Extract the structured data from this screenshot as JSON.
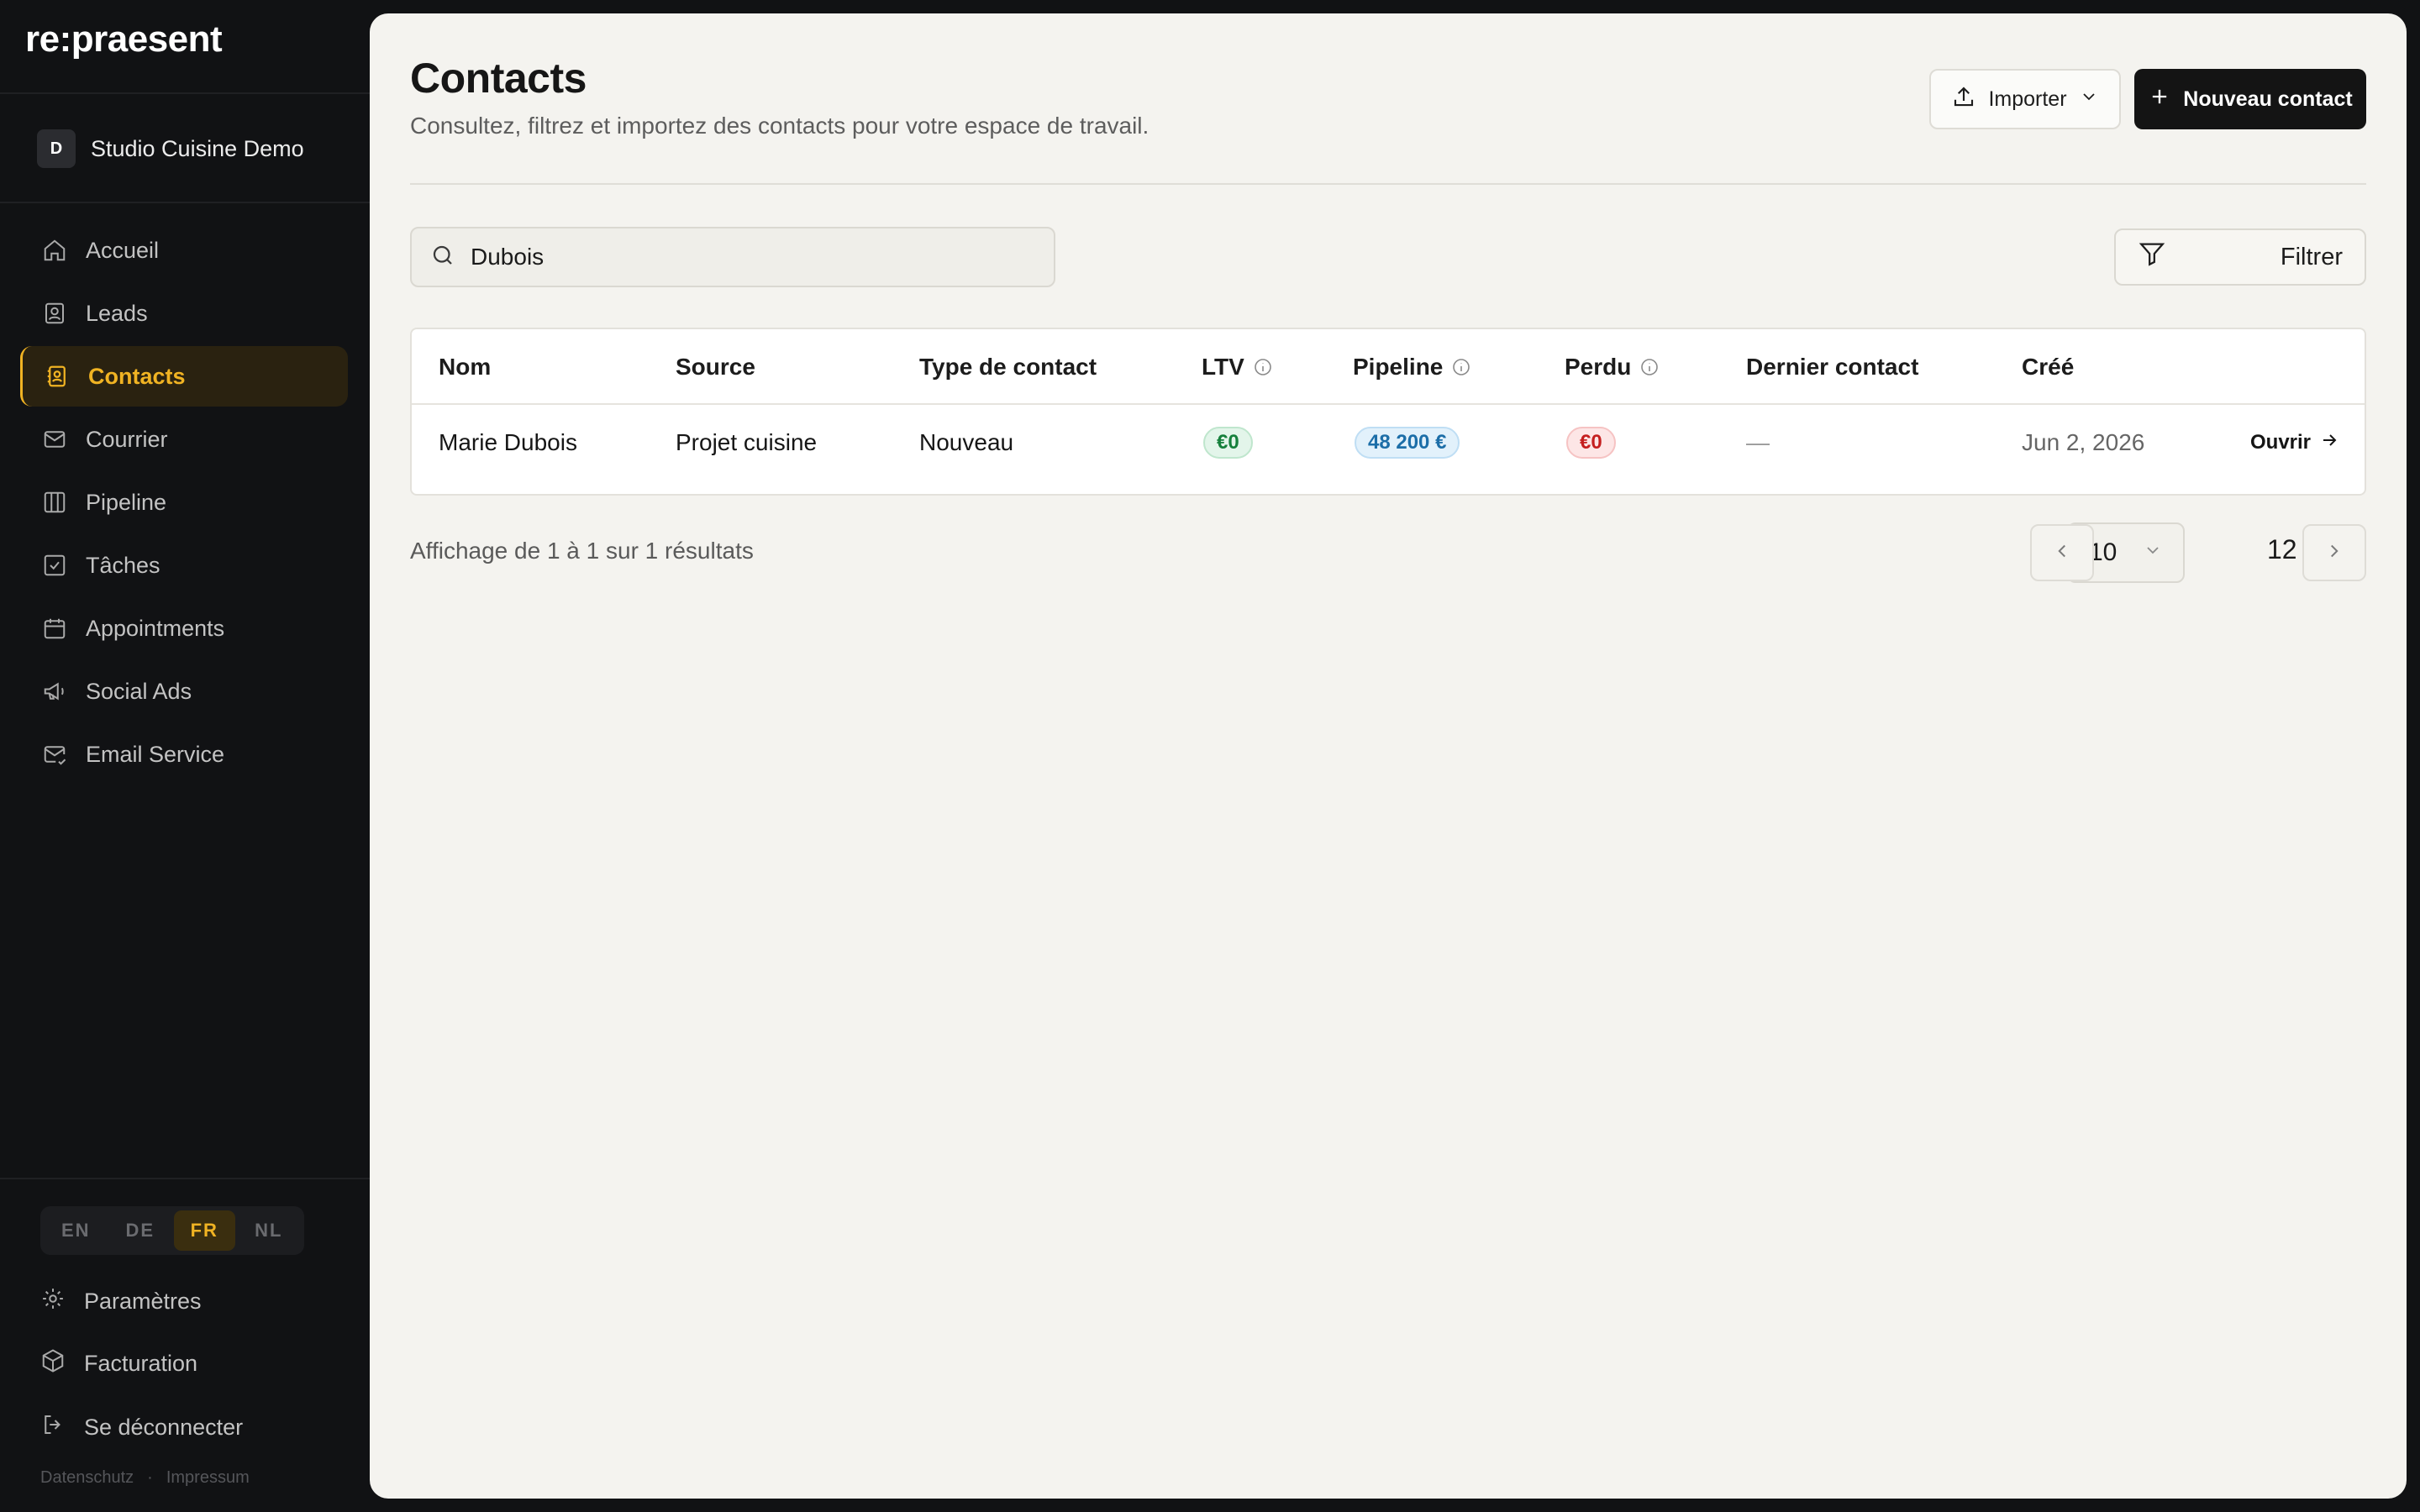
{
  "app": {
    "logo": "re:praesent"
  },
  "workspace": {
    "initial": "D",
    "name": "Studio Cuisine Demo"
  },
  "sidebar": {
    "items": [
      {
        "label": "Accueil",
        "icon": "home-icon"
      },
      {
        "label": "Leads",
        "icon": "contact-card-icon"
      },
      {
        "label": "Contacts",
        "icon": "address-book-icon",
        "active": true
      },
      {
        "label": "Courrier",
        "icon": "mail-icon"
      },
      {
        "label": "Pipeline",
        "icon": "columns-icon"
      },
      {
        "label": "Tâches",
        "icon": "checkbox-icon"
      },
      {
        "label": "Appointments",
        "icon": "calendar-icon"
      },
      {
        "label": "Social Ads",
        "icon": "megaphone-icon"
      },
      {
        "label": "Email Service",
        "icon": "mail-check-icon"
      }
    ],
    "languages": [
      "EN",
      "DE",
      "FR",
      "NL"
    ],
    "active_language": "FR",
    "settings_label": "Paramètres",
    "billing_label": "Facturation",
    "logout_label": "Se déconnecter",
    "footer": {
      "privacy": "Datenschutz",
      "separator": "·",
      "imprint": "Impressum"
    }
  },
  "header": {
    "title": "Contacts",
    "subtitle": "Consultez, filtrez et importez des contacts pour votre espace de travail.",
    "import_label": "Importer",
    "new_contact_label": "Nouveau contact"
  },
  "search": {
    "value": "Dubois",
    "placeholder": ""
  },
  "filter": {
    "label": "Filtrer"
  },
  "table": {
    "columns": [
      "Nom",
      "Source",
      "Type de contact",
      "LTV",
      "Pipeline",
      "Perdu",
      "Dernier contact",
      "Créé"
    ],
    "rows": [
      {
        "nom": "Marie Dubois",
        "source": "Projet cuisine",
        "type": "Nouveau",
        "ltv": "€0",
        "pipeline": "48 200 €",
        "perdu": "€0",
        "dernier_contact": "—",
        "cree": "Jun 2, 2026",
        "action": "Ouvrir"
      }
    ]
  },
  "pagination": {
    "summary": "Affichage de 1 à 1 sur 1 résultats",
    "page_size": "10",
    "page_label": "12"
  },
  "colors": {
    "accent": "#f0b323",
    "sidebar_bg": "#111214",
    "main_bg": "#f4f3ef",
    "primary_button": "#141414"
  }
}
